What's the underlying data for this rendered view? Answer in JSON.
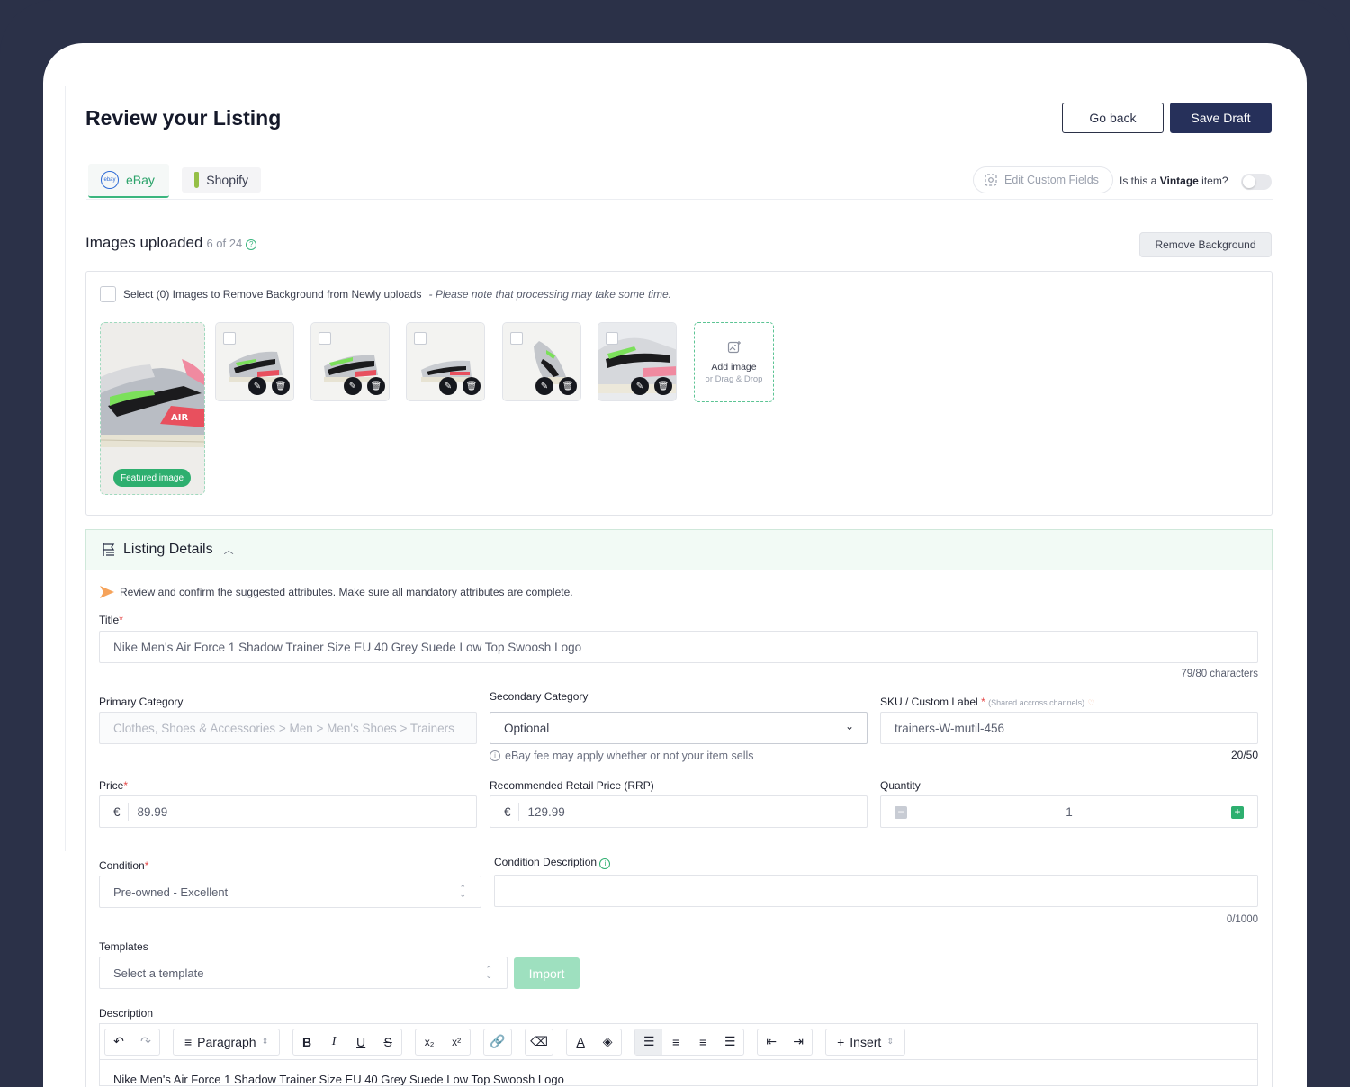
{
  "page": {
    "title": "Review your Listing"
  },
  "actions": {
    "go_back": "Go back",
    "save_draft": "Save Draft"
  },
  "tabs": [
    {
      "label": "eBay",
      "icon": "ebay-logo",
      "active": true
    },
    {
      "label": "Shopify",
      "icon": "shopify-logo",
      "active": false
    }
  ],
  "custom_fields": {
    "label": "Edit Custom Fields"
  },
  "vintage": {
    "prefix": "Is this a",
    "bold": "Vintage",
    "suffix": "item?",
    "enabled": false
  },
  "images": {
    "title": "Images uploaded",
    "count": "6 of 24",
    "remove_bg": "Remove Background",
    "select_text": "Select (0) Images to Remove Background from Newly uploads",
    "select_note": "- Please note that processing may take some time.",
    "featured_label": "Featured image",
    "thumb_count": 5,
    "add_line1": "Add image",
    "add_line2": "or Drag & Drop"
  },
  "listing": {
    "section_title": "Listing Details",
    "hint": "Review and confirm the suggested attributes. Make sure all mandatory attributes are complete.",
    "title_label": "Title",
    "title_value": "Nike Men's Air Force 1 Shadow Trainer Size EU 40 Grey Suede Low Top Swoosh Logo",
    "title_counter": "79/80 characters",
    "primary_cat_label": "Primary Category",
    "primary_cat_value": "Clothes, Shoes & Accessories > Men > Men's Shoes > Trainers",
    "secondary_cat_label": "Secondary Category",
    "secondary_cat_value": "Optional",
    "secondary_note": "eBay fee may apply whether or not your item sells",
    "sku_label": "SKU / Custom Label",
    "sku_sub": "(Shared accross channels)",
    "sku_value": "trainers-W-mutil-456",
    "sku_counter": "20/50",
    "price_label": "Price",
    "price_currency": "€",
    "price_value": "89.99",
    "rrp_label": "Recommended Retail Price (RRP)",
    "rrp_currency": "€",
    "rrp_value": "129.99",
    "qty_label": "Quantity",
    "qty_value": "1",
    "condition_label": "Condition",
    "condition_value": "Pre-owned - Excellent",
    "cond_desc_label": "Condition Description",
    "cond_desc_counter": "0/1000",
    "templates_label": "Templates",
    "templates_placeholder": "Select a template",
    "import_label": "Import",
    "description_label": "Description",
    "description_text": "Nike Men's Air Force 1 Shadow Trainer Size EU 40 Grey Suede Low Top Swoosh Logo"
  },
  "editor": {
    "paragraph": "Paragraph",
    "insert": "Insert"
  },
  "colors": {
    "accent": "#2eaf6f",
    "primary": "#26305a",
    "frame": "#2b3148"
  }
}
